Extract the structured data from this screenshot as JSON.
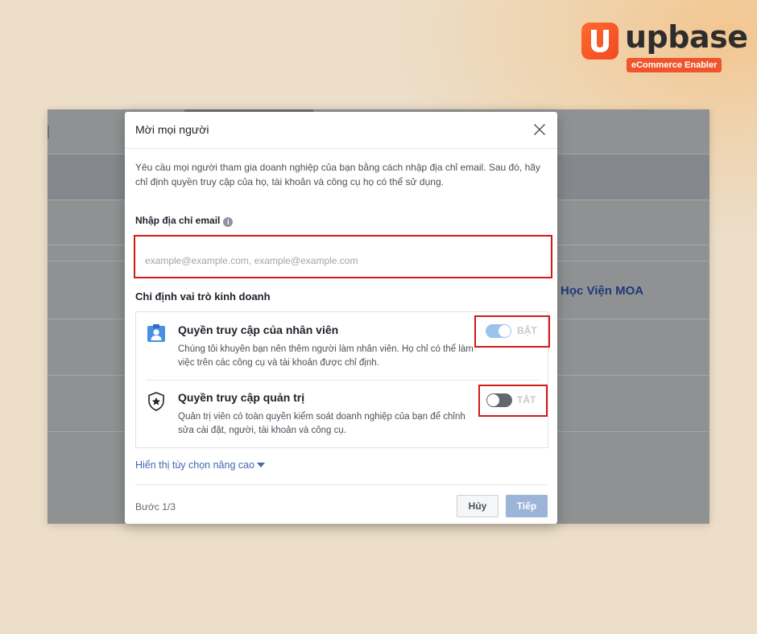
{
  "brand": {
    "name": "upbase",
    "tagline": "eCommerce Enabler",
    "accent": "#f0542a"
  },
  "background": {
    "link_text": "Học Viện MOA"
  },
  "dialog": {
    "title": "Mời mọi người",
    "close_icon": "close-icon",
    "description": "Yêu cầu mọi người tham gia doanh nghiệp của bạn bằng cách nhập địa chỉ email. Sau đó, hãy chỉ định quyền truy cập của họ, tài khoản và công cụ họ có thể sử dụng.",
    "email": {
      "label": "Nhập địa chỉ email",
      "info_icon": "info-icon",
      "placeholder": "example@example.com, example@example.com",
      "value": ""
    },
    "roles_label": "Chỉ định vai trò kinh doanh",
    "roles": [
      {
        "icon": "employee-badge-icon",
        "title": "Quyền truy cập của nhân viên",
        "description": "Chúng tôi khuyên bạn nên thêm người làm nhân viên. Họ chỉ có thể làm việc trên các công cụ và tài khoản được chỉ định.",
        "toggle_state": "on",
        "toggle_label": "BẬT"
      },
      {
        "icon": "admin-shield-icon",
        "title": "Quyền truy cập quản trị",
        "description": "Quản trị viên có toàn quyền kiểm soát doanh nghiệp của bạn để chỉnh sửa cài đặt, người, tài khoản và công cụ.",
        "toggle_state": "off",
        "toggle_label": "TẮT"
      }
    ],
    "advanced_link": "Hiển thị tùy chọn nâng cao",
    "step": "Bước 1/3",
    "buttons": {
      "cancel": "Hủy",
      "next": "Tiếp"
    }
  }
}
